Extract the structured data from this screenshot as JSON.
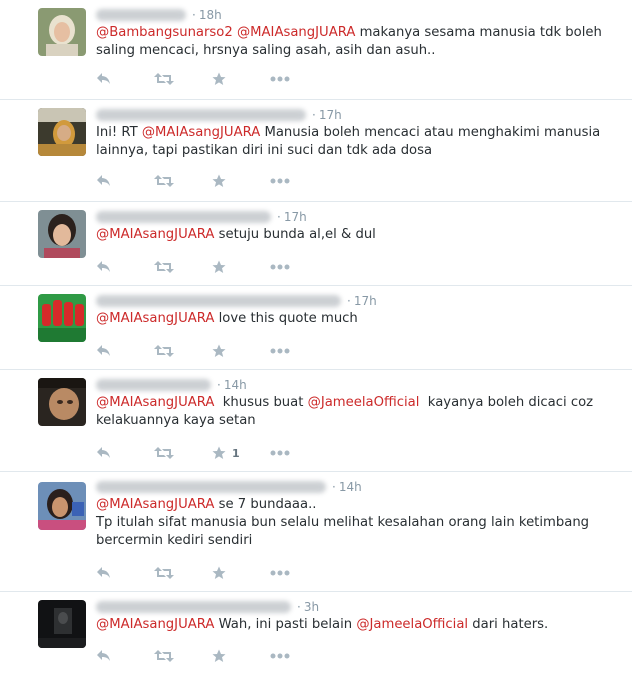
{
  "colors": {
    "mention": "#cc2a2a",
    "meta": "#8899a6",
    "icon": "#aab8c2"
  },
  "icons": [
    "reply-icon",
    "retweet-icon",
    "favorite-icon",
    "more-icon"
  ],
  "tweets": [
    {
      "time": "18h",
      "mentions": [
        "@Bambangsunarso2",
        "@MAIAsangJUARA"
      ],
      "text": "makanya sesama manusia tdk boleh saling mencaci, hrsnya saling asah, asih dan asuh..",
      "fav_count": ""
    },
    {
      "time": "17h",
      "prefix": "Ini! RT",
      "mentions": [
        "@MAIAsangJUARA"
      ],
      "text": "Manusia boleh mencaci atau menghakimi manusia lainnya, tapi pastikan diri ini suci dan tdk ada dosa",
      "fav_count": ""
    },
    {
      "time": "17h",
      "mentions": [
        "@MAIAsangJUARA"
      ],
      "text": "setuju bunda al,el & dul",
      "fav_count": ""
    },
    {
      "time": "17h",
      "mentions": [
        "@MAIAsangJUARA"
      ],
      "text": "love this quote much",
      "fav_count": ""
    },
    {
      "time": "14h",
      "mentions": [
        "@MAIAsangJUARA",
        "@JameelaOfficial"
      ],
      "text_mid": "khusus buat",
      "text": "kayanya boleh dicaci coz kelakuannya kaya setan",
      "fav_count": "1"
    },
    {
      "time": "14h",
      "mentions": [
        "@MAIAsangJUARA"
      ],
      "text_first": "se 7 bundaaa..",
      "text": "Tp itulah sifat manusia bun selalu melihat kesalahan orang lain ketimbang bercermin kediri sendiri",
      "fav_count": ""
    },
    {
      "time": "3h",
      "mentions": [
        "@MAIAsangJUARA",
        "@JameelaOfficial"
      ],
      "text_mid": "Wah, ini pasti belain",
      "text": "dari haters.",
      "fav_count": ""
    }
  ]
}
